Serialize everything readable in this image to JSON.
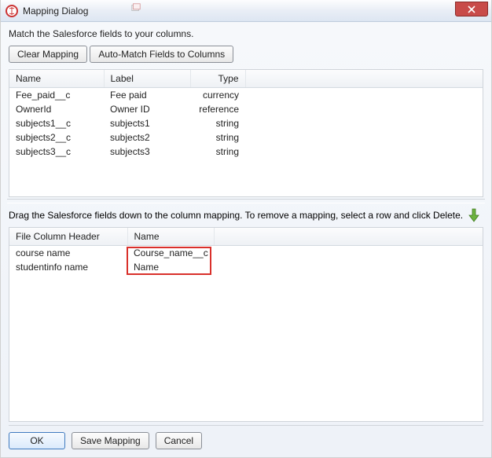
{
  "window": {
    "title": "Mapping Dialog",
    "close_aria": "Close"
  },
  "instruction_top": "Match the Salesforce fields to your columns.",
  "buttons": {
    "clear_mapping": "Clear Mapping",
    "auto_match": "Auto-Match Fields to Columns",
    "ok": "OK",
    "save_mapping": "Save Mapping",
    "cancel": "Cancel"
  },
  "fields_table": {
    "headers": {
      "name": "Name",
      "label": "Label",
      "type": "Type"
    },
    "rows": [
      {
        "name": "Fee_paid__c",
        "label": "Fee paid",
        "type": "currency"
      },
      {
        "name": "OwnerId",
        "label": "Owner ID",
        "type": "reference"
      },
      {
        "name": "subjects1__c",
        "label": "subjects1",
        "type": "string"
      },
      {
        "name": "subjects2__c",
        "label": "subjects2",
        "type": "string"
      },
      {
        "name": "subjects3__c",
        "label": "subjects3",
        "type": "string"
      }
    ]
  },
  "instruction_drag": "Drag the Salesforce fields down to the column mapping.  To remove a mapping, select a row and click Delete.",
  "mapping_table": {
    "headers": {
      "file_col": "File Column Header",
      "name": "Name"
    },
    "rows": [
      {
        "file_col": "course name",
        "name": "Course_name__c"
      },
      {
        "file_col": "studentinfo name",
        "name": "Name"
      }
    ]
  }
}
